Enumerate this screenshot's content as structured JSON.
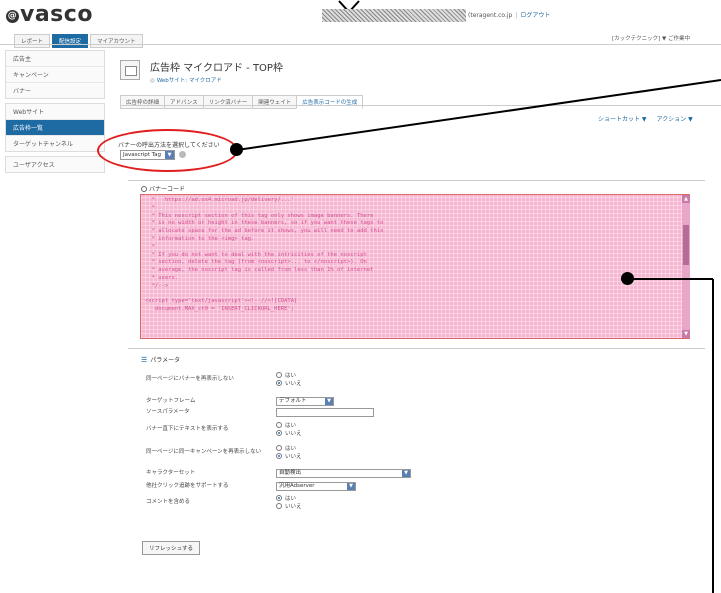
{
  "header": {
    "logo_text": "vasco",
    "logo_mark": "@",
    "top_links": {
      "account": "(teragent.co.jp",
      "logout": "ログアウト"
    },
    "user_menu": "[カックテクニック] ▼  ご作業中"
  },
  "main_tabs": [
    {
      "label": "レポート",
      "active": false
    },
    {
      "label": "配信設定",
      "active": true
    },
    {
      "label": "マイアカウント",
      "active": false
    }
  ],
  "sidebar": {
    "groups": [
      {
        "items": [
          {
            "label": "広告主",
            "active": false
          },
          {
            "label": "キャンペーン",
            "active": false
          },
          {
            "label": "バナー",
            "active": false
          }
        ]
      },
      {
        "items": [
          {
            "label": "Webサイト",
            "active": false
          },
          {
            "label": "広告枠一覧",
            "active": true
          },
          {
            "label": "ターゲットチャンネル",
            "active": false
          }
        ]
      },
      {
        "items": [
          {
            "label": "ユーザアクセス",
            "active": false
          }
        ]
      }
    ]
  },
  "page": {
    "title": "広告枠 マイクロアド - TOP枠",
    "subtitle": "Webサイト: マイクロアド",
    "subtabs": [
      {
        "label": "広告枠の詳細",
        "active": false
      },
      {
        "label": "アドバンス",
        "active": false
      },
      {
        "label": "リンク済バナー",
        "active": false
      },
      {
        "label": "関連ウェイト",
        "active": false
      },
      {
        "label": "広告表示コードの生成",
        "active": true
      }
    ],
    "actions": {
      "shortcut": "ショートカット ▼",
      "action": "アクション ▼"
    }
  },
  "banner_method": {
    "label": "バナーの呼出方法を選択してください",
    "selected": "Javascript Tag"
  },
  "code": {
    "title": "バナーコード",
    "lines": [
      "  *   https://ad.ox4.microad.jp/delivery/...'",
      "  *",
      "  * This noscript section of this tag only shows image banners. There",
      "  * is no width or height in these banners, so if you want these tags to",
      "  * allocate space for the ad before it shows, you will need to add this",
      "  * information to the <img> tag.",
      "  *",
      "  * If you do not want to deal with the intricities of the noscript",
      "  * section, delete the tag (from <noscript>... to </noscript>). On",
      "  * average, the noscript tag is called from less than 1% of internet",
      "  * users.",
      "  */-->",
      "",
      "<script type='text/javascript'><!--//<![CDATA[",
      "   document.MAX_ct0 = 'INSERT_CLICKURL_HERE';"
    ]
  },
  "params": {
    "title": "パラメータ",
    "rows": [
      {
        "label": "同一ページにバナーを再表示しない",
        "type": "radio",
        "options": [
          "はい",
          "いいえ"
        ],
        "selected": 1
      },
      {
        "label": "ターゲットフレーム",
        "type": "select",
        "value": "デフォルト"
      },
      {
        "label": "ソースパラメータ",
        "type": "text",
        "value": ""
      },
      {
        "label": "バナー直下にテキストを表示する",
        "type": "radio",
        "options": [
          "はい",
          "いいえ"
        ],
        "selected": 1
      },
      {
        "label": "同一ページに同一キャンペーンを再表示しない",
        "type": "radio",
        "options": [
          "はい",
          "いいえ"
        ],
        "selected": 1
      },
      {
        "label": "キャラクターセット",
        "type": "select",
        "value": "自動検出"
      },
      {
        "label": "他社クリック追跡をサポートする",
        "type": "select",
        "value": "汎用Adserver"
      },
      {
        "label": "コメントを含める",
        "type": "radio",
        "options": [
          "はい",
          "いいえ"
        ],
        "selected": 0
      }
    ],
    "refresh_label": "リフレッシュする"
  },
  "annotation_colors": {
    "oval": "#e01e1e",
    "highlight": "#f7b6d2",
    "accent": "#1e6aa3"
  }
}
